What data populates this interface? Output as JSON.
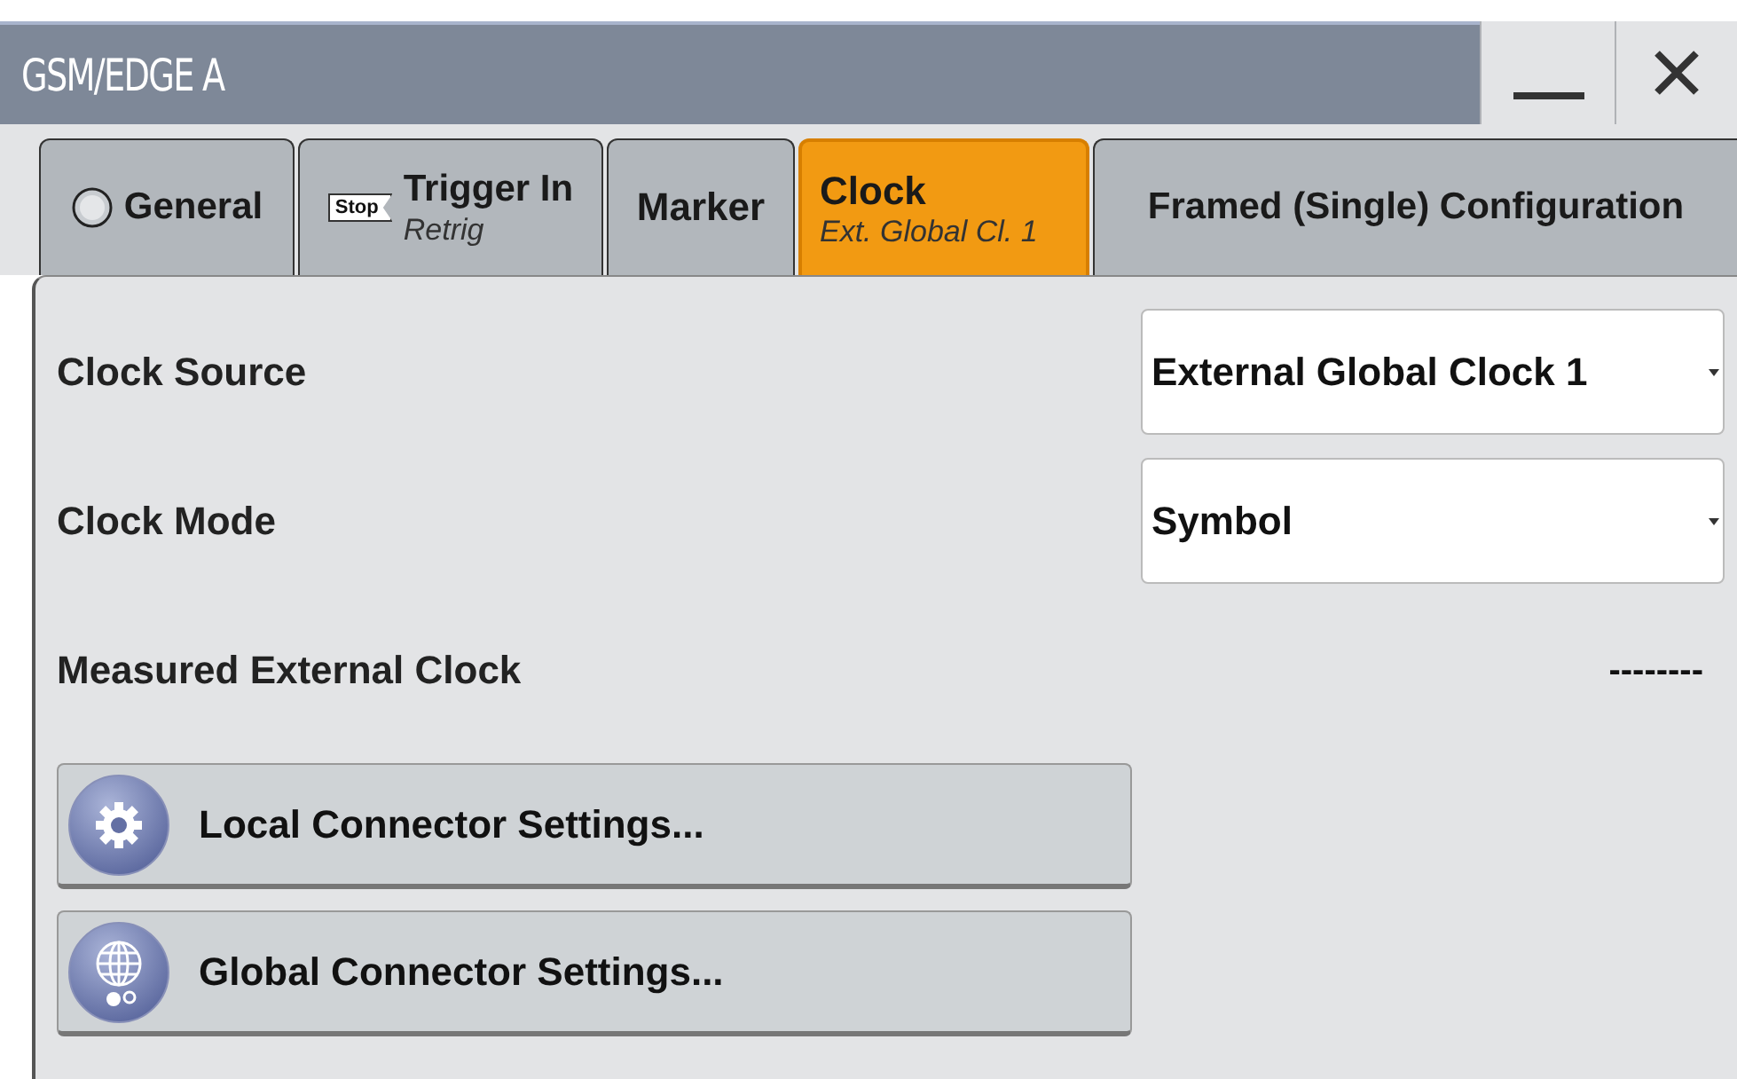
{
  "window": {
    "title": "GSM/EDGE A",
    "controls": [
      {
        "kind": "minimize"
      },
      {
        "kind": "close"
      }
    ]
  },
  "tabs": [
    {
      "label": "General",
      "icon": {
        "kind": "led"
      },
      "selected": false
    },
    {
      "label": "Trigger In",
      "sublabel": "Retrig",
      "icon": {
        "kind": "stop",
        "text": "Stop"
      },
      "selected": false
    },
    {
      "label": "Marker",
      "selected": false
    },
    {
      "label": "Clock",
      "sublabel": "Ext. Global Cl. 1",
      "selected": true
    },
    {
      "label": "Framed (Single) Configuration",
      "selected": false
    }
  ],
  "settings": [
    {
      "kind": "dropdown",
      "label": "Clock Source",
      "value": "External Global Clock 1"
    },
    {
      "kind": "dropdown",
      "label": "Clock Mode",
      "value": "Symbol"
    },
    {
      "kind": "reading",
      "label": "Measured External Clock",
      "value": "--------"
    }
  ],
  "buttons": [
    {
      "label": "Local Connector Settings...",
      "kind": "gear"
    },
    {
      "label": "Global Connector Settings...",
      "kind": "globe"
    }
  ]
}
